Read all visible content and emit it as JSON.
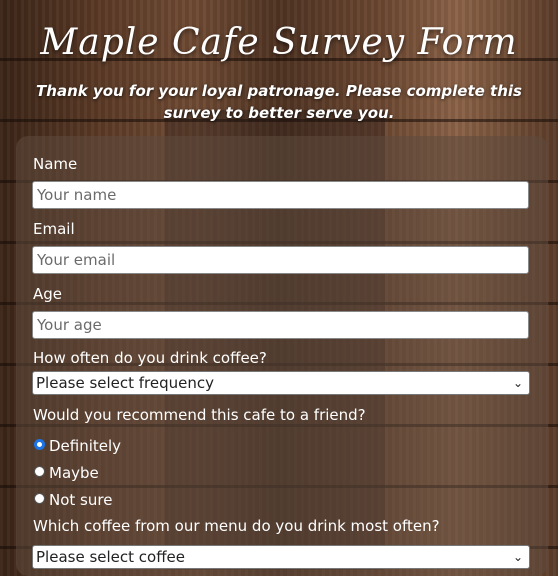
{
  "header": {
    "title": "Maple Cafe Survey Form",
    "subtitle": "Thank you for your loyal patronage. Please complete this survey to better serve you."
  },
  "form": {
    "name": {
      "label": "Name",
      "placeholder": "Your name"
    },
    "email": {
      "label": "Email",
      "placeholder": "Your email"
    },
    "age": {
      "label": "Age",
      "placeholder": "Your age"
    },
    "frequency": {
      "label": "How often do you drink coffee?",
      "selected": "Please select frequency"
    },
    "recommend": {
      "label": "Would you recommend this cafe to a friend?",
      "options": [
        {
          "label": "Definitely",
          "checked": true
        },
        {
          "label": "Maybe",
          "checked": false
        },
        {
          "label": "Not sure",
          "checked": false
        }
      ]
    },
    "coffee": {
      "label": "Which coffee from our menu do you drink most often?",
      "selected": "Please select coffee"
    }
  },
  "colors": {
    "accent": "#1a73e8",
    "text": "#ffffff"
  }
}
